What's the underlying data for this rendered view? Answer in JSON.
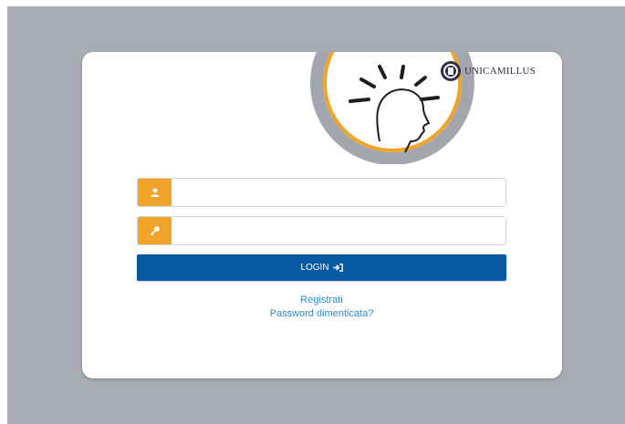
{
  "brand": {
    "name": "UNICAMILLUS"
  },
  "form": {
    "username": {
      "value": "",
      "placeholder": "",
      "icon": "user-icon"
    },
    "password": {
      "value": "",
      "placeholder": "",
      "icon": "key-icon"
    },
    "login_label": "LOGIN",
    "login_icon": "sign-in-icon"
  },
  "links": {
    "register": "Registrati",
    "forgot_password": "Password dimenticata?"
  },
  "colors": {
    "background": "#a9acb2",
    "accent_orange": "#f0a42a",
    "button_blue": "#075aa1",
    "link_blue": "#2a8ad1"
  }
}
